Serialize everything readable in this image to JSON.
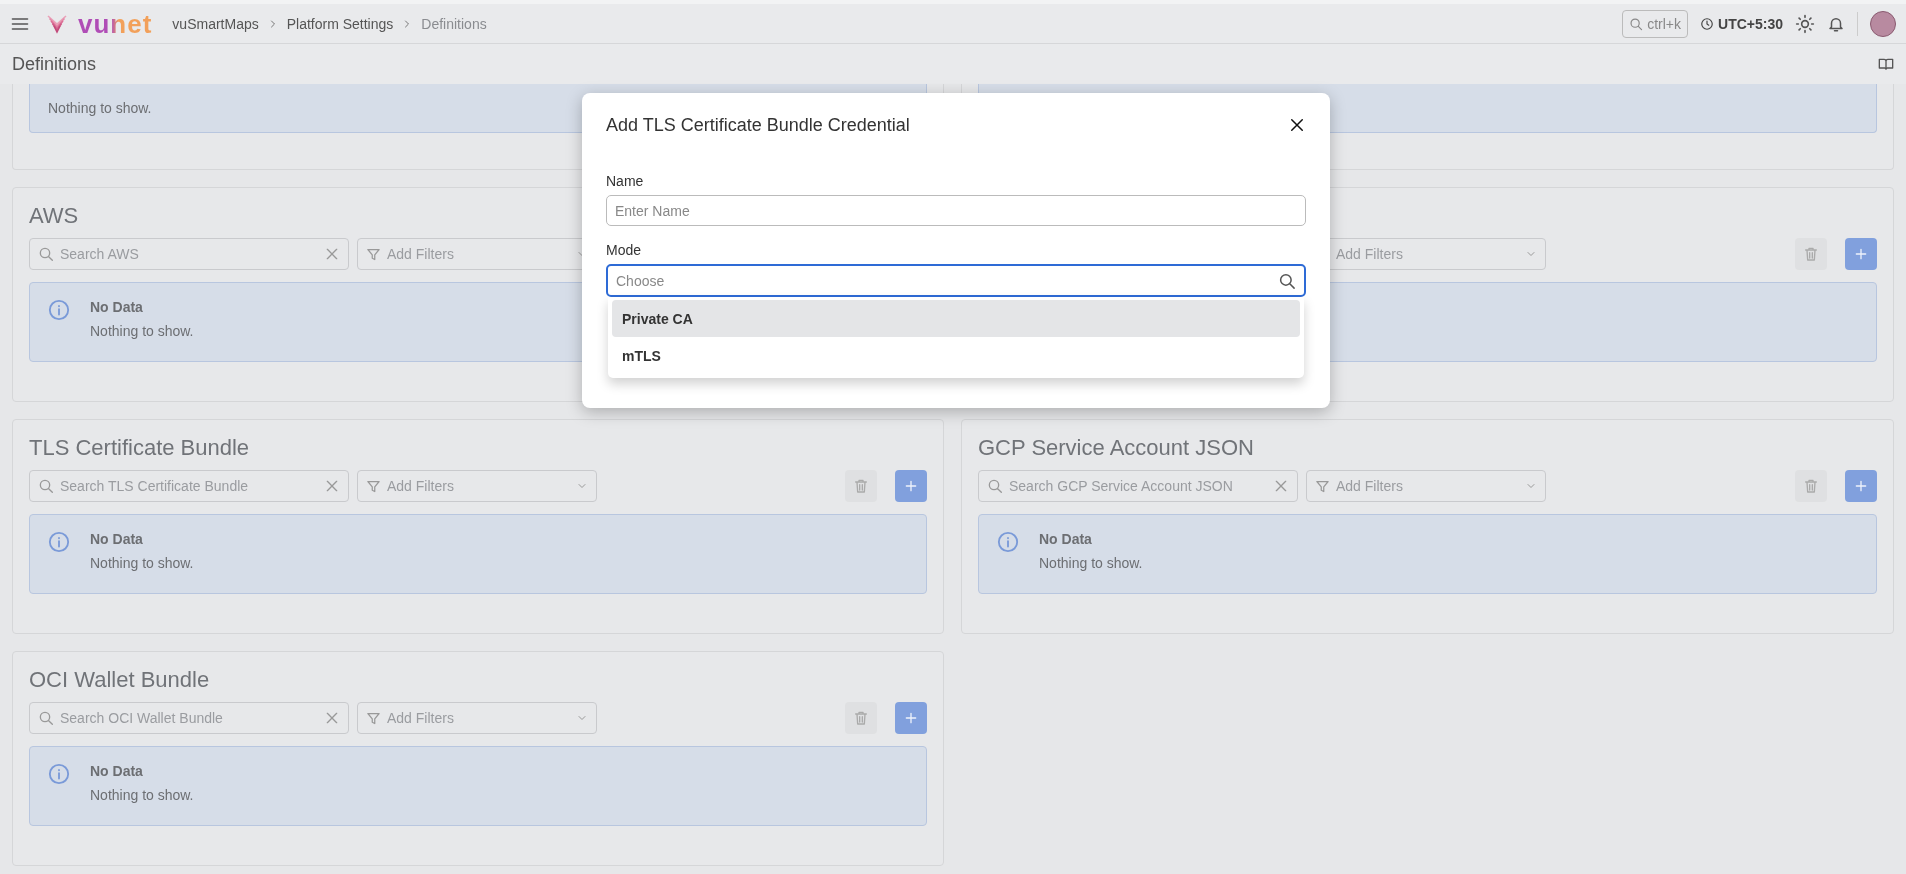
{
  "header": {
    "logo_text": "vunet",
    "breadcrumb": [
      {
        "label": "vuSmartMaps",
        "selected": false
      },
      {
        "label": "Platform Settings",
        "selected": false
      },
      {
        "label": "Definitions",
        "selected": true
      }
    ],
    "search_shortcut": "ctrl+k",
    "timezone": "UTC+5:30"
  },
  "page_title": "Definitions",
  "cards": [
    {
      "kind": "partial",
      "alert": {
        "message": "Nothing to show."
      }
    },
    {
      "kind": "partial"
    },
    {
      "kind": "full",
      "title": "AWS",
      "search_placeholder": "Search AWS",
      "filter_placeholder": "Add Filters",
      "alert": {
        "title": "No Data",
        "message": "Nothing to show."
      }
    },
    {
      "kind": "covered",
      "filter_placeholder": "Add Filters"
    },
    {
      "kind": "full",
      "title": "TLS Certificate Bundle",
      "search_placeholder": "Search TLS Certificate Bundle",
      "filter_placeholder": "Add Filters",
      "alert": {
        "title": "No Data",
        "message": "Nothing to show."
      }
    },
    {
      "kind": "full",
      "title": "GCP Service Account JSON",
      "search_placeholder": "Search GCP Service Account JSON",
      "filter_placeholder": "Add Filters",
      "alert": {
        "title": "No Data",
        "message": "Nothing to show."
      }
    },
    {
      "kind": "full",
      "title": "OCI Wallet Bundle",
      "search_placeholder": "Search OCI Wallet Bundle",
      "filter_placeholder": "Add Filters",
      "alert": {
        "title": "No Data",
        "message": "Nothing to show."
      }
    }
  ],
  "dialog": {
    "title": "Add TLS Certificate Bundle Credential",
    "fields": [
      {
        "kind": "text",
        "label": "Name",
        "placeholder": "Enter Name"
      },
      {
        "kind": "select",
        "label": "Mode",
        "placeholder": "Choose",
        "options": [
          {
            "label": "Private CA",
            "selected": true
          },
          {
            "label": "mTLS",
            "selected": false
          }
        ]
      }
    ]
  }
}
